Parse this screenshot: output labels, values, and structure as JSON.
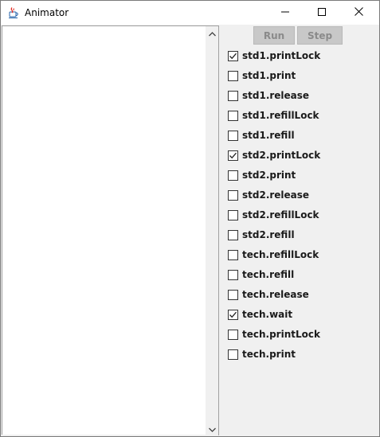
{
  "window": {
    "title": "Animator",
    "app_icon": "java-cup-icon",
    "controls": [
      "minimize-icon",
      "maximize-icon",
      "close-icon"
    ]
  },
  "toolbar": {
    "run_label": "Run",
    "step_label": "Step"
  },
  "checkboxes": [
    {
      "label": "std1.printLock",
      "checked": true
    },
    {
      "label": "std1.print",
      "checked": false
    },
    {
      "label": "std1.release",
      "checked": false
    },
    {
      "label": "std1.refillLock",
      "checked": false
    },
    {
      "label": "std1.refill",
      "checked": false
    },
    {
      "label": "std2.printLock",
      "checked": true
    },
    {
      "label": "std2.print",
      "checked": false
    },
    {
      "label": "std2.release",
      "checked": false
    },
    {
      "label": "std2.refillLock",
      "checked": false
    },
    {
      "label": "std2.refill",
      "checked": false
    },
    {
      "label": "tech.refillLock",
      "checked": false
    },
    {
      "label": "tech.refill",
      "checked": false
    },
    {
      "label": "tech.release",
      "checked": false
    },
    {
      "label": "tech.wait",
      "checked": true
    },
    {
      "label": "tech.printLock",
      "checked": false
    },
    {
      "label": "tech.print",
      "checked": false
    }
  ],
  "scrollbar": {
    "up_icon": "chevron-up-icon",
    "down_icon": "chevron-down-icon"
  }
}
